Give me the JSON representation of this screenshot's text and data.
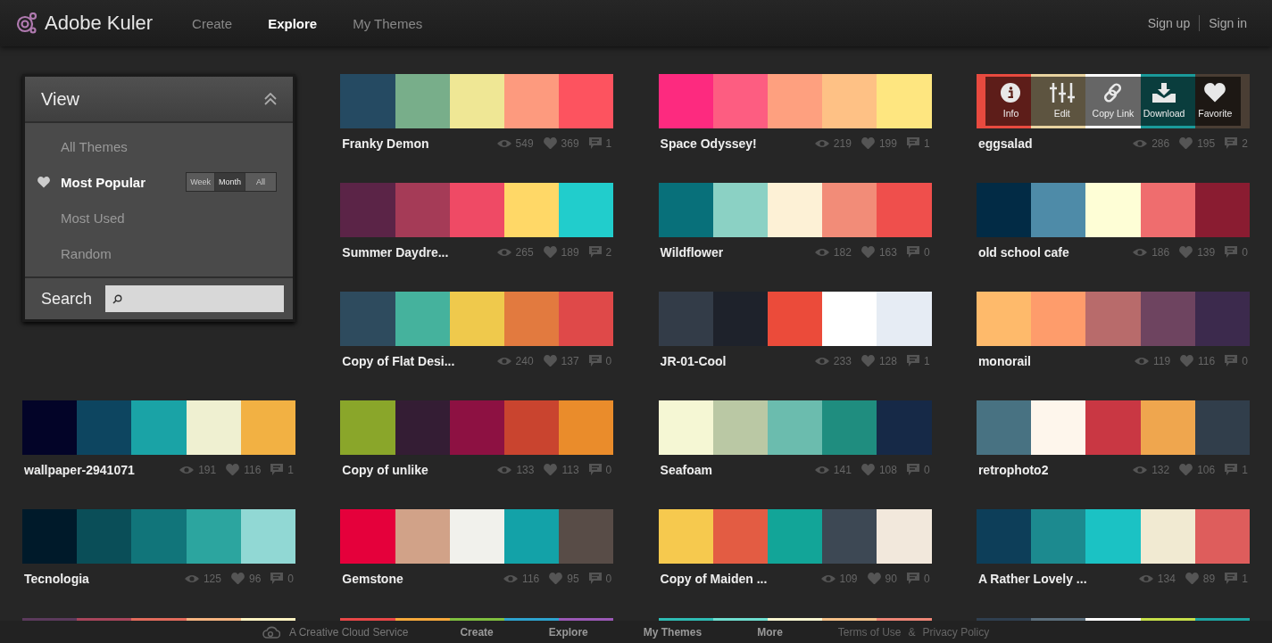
{
  "header": {
    "logo": "Adobe Kuler",
    "nav": [
      {
        "label": "Create",
        "selected": false
      },
      {
        "label": "Explore",
        "selected": true
      },
      {
        "label": "My Themes",
        "selected": false
      }
    ],
    "account": [
      "Sign up",
      "Sign in"
    ]
  },
  "sidebar": {
    "title": "View",
    "items": [
      {
        "label": "All Themes",
        "selected": false
      },
      {
        "label": "Most Popular",
        "selected": true
      },
      {
        "label": "Most Used",
        "selected": false
      },
      {
        "label": "Random",
        "selected": false
      }
    ],
    "range": [
      {
        "label": "Week",
        "selected": false
      },
      {
        "label": "Month",
        "selected": true
      },
      {
        "label": "All",
        "selected": false
      }
    ],
    "search_label": "Search"
  },
  "hover_actions": [
    {
      "kind": "info",
      "label": "Info"
    },
    {
      "kind": "edit",
      "label": "Edit"
    },
    {
      "kind": "link",
      "label": "Copy Link"
    },
    {
      "kind": "download",
      "label": "Download"
    },
    {
      "kind": "favorite",
      "label": "Favorite"
    }
  ],
  "themes": [
    {
      "name": "Franky Demon",
      "swatches": [
        {
          "color": "#254a62"
        },
        {
          "color": "#78ae8a"
        },
        {
          "color": "#efe795"
        },
        {
          "color": "#fd9a7e"
        },
        {
          "color": "#fd535f"
        }
      ],
      "views": "549",
      "likes": "369",
      "comments": "1",
      "hovered": false
    },
    {
      "name": "Space Odyssey!",
      "swatches": [
        {
          "color": "#fd2a7f"
        },
        {
          "color": "#fd5d81"
        },
        {
          "color": "#fea07f"
        },
        {
          "color": "#fec185"
        },
        {
          "color": "#fee680"
        }
      ],
      "views": "219",
      "likes": "199",
      "comments": "1",
      "hovered": false
    },
    {
      "name": "eggsalad",
      "swatches": [
        {
          "color": "#e84a3f"
        },
        {
          "color": "#e8d3a0"
        },
        {
          "color": "#ffffff"
        },
        {
          "color": "#1a9a9a"
        },
        {
          "color": "#4a3e34"
        }
      ],
      "views": "286",
      "likes": "195",
      "comments": "2",
      "hovered": true
    },
    {
      "name": "Summer Daydre...",
      "swatches": [
        {
          "color": "#5b2447"
        },
        {
          "color": "#a53b57"
        },
        {
          "color": "#ef4a65"
        },
        {
          "color": "#ffd867"
        },
        {
          "color": "#21cdcc"
        }
      ],
      "views": "265",
      "likes": "189",
      "comments": "2",
      "hovered": false
    },
    {
      "name": "Wildflower",
      "swatches": [
        {
          "color": "#08707a"
        },
        {
          "color": "#8bd1c4"
        },
        {
          "color": "#fdf1d6"
        },
        {
          "color": "#f28c78"
        },
        {
          "color": "#ef4f4c"
        }
      ],
      "views": "182",
      "likes": "163",
      "comments": "0",
      "hovered": false
    },
    {
      "name": "old school cafe",
      "swatches": [
        {
          "color": "#022b45"
        },
        {
          "color": "#4e8ba8"
        },
        {
          "color": "#fefed6"
        },
        {
          "color": "#ef6d6e"
        },
        {
          "color": "#8a1c31"
        }
      ],
      "views": "186",
      "likes": "139",
      "comments": "0",
      "hovered": false
    },
    {
      "name": "Copy of Flat Desi...",
      "swatches": [
        {
          "color": "#2e4b5e"
        },
        {
          "color": "#45b29d"
        },
        {
          "color": "#efc94c"
        },
        {
          "color": "#e27a3f"
        },
        {
          "color": "#df4949"
        }
      ],
      "views": "240",
      "likes": "137",
      "comments": "0",
      "hovered": false
    },
    {
      "name": "JR-01-Cool",
      "swatches": [
        {
          "color": "#333c48"
        },
        {
          "color": "#1e222b"
        },
        {
          "color": "#eb4b3a"
        },
        {
          "color": "#ffffff"
        },
        {
          "color": "#e6ecf4"
        }
      ],
      "views": "233",
      "likes": "128",
      "comments": "1",
      "hovered": false
    },
    {
      "name": "monorail",
      "swatches": [
        {
          "color": "#feba6b"
        },
        {
          "color": "#fe9c6b"
        },
        {
          "color": "#b86b6b"
        },
        {
          "color": "#6e4460"
        },
        {
          "color": "#3c2a4d"
        }
      ],
      "views": "119",
      "likes": "116",
      "comments": "0",
      "hovered": false
    },
    {
      "name": "wallpaper-2941071",
      "swatches": [
        {
          "color": "#030428"
        },
        {
          "color": "#0d4560"
        },
        {
          "color": "#1aa3a6"
        },
        {
          "color": "#eff0d1"
        },
        {
          "color": "#f2b143"
        }
      ],
      "views": "191",
      "likes": "116",
      "comments": "1",
      "hovered": false
    },
    {
      "name": "Copy of unlike",
      "swatches": [
        {
          "color": "#8aa62a"
        },
        {
          "color": "#341d34"
        },
        {
          "color": "#8d1142"
        },
        {
          "color": "#c9442f"
        },
        {
          "color": "#ea8c2b"
        }
      ],
      "views": "133",
      "likes": "113",
      "comments": "0",
      "hovered": false
    },
    {
      "name": "Seafoam",
      "swatches": [
        {
          "color": "#f5f7d4"
        },
        {
          "color": "#bac8a4"
        },
        {
          "color": "#6bbcae"
        },
        {
          "color": "#1f8d7f"
        },
        {
          "color": "#162947"
        }
      ],
      "views": "141",
      "likes": "108",
      "comments": "0",
      "hovered": false
    },
    {
      "name": "retrophoto2",
      "swatches": [
        {
          "color": "#487282"
        },
        {
          "color": "#fef6ec"
        },
        {
          "color": "#c93743"
        },
        {
          "color": "#efa64e"
        },
        {
          "color": "#313e4b"
        }
      ],
      "views": "132",
      "likes": "106",
      "comments": "1",
      "hovered": false
    },
    {
      "name": "Tecnologia",
      "swatches": [
        {
          "color": "#001a2a"
        },
        {
          "color": "#0a4e58"
        },
        {
          "color": "#11757a"
        },
        {
          "color": "#2ca59f"
        },
        {
          "color": "#91d8d4"
        }
      ],
      "views": "125",
      "likes": "96",
      "comments": "0",
      "hovered": false
    },
    {
      "name": "Gemstone",
      "swatches": [
        {
          "color": "#e5003b"
        },
        {
          "color": "#d1a288"
        },
        {
          "color": "#f1f1ec"
        },
        {
          "color": "#13a2a8"
        },
        {
          "color": "#584c47"
        }
      ],
      "views": "116",
      "likes": "95",
      "comments": "0",
      "hovered": false
    },
    {
      "name": "Copy of Maiden ...",
      "swatches": [
        {
          "color": "#f6c94e"
        },
        {
          "color": "#e35c43"
        },
        {
          "color": "#12a598"
        },
        {
          "color": "#3d4854"
        },
        {
          "color": "#f2e8dc"
        }
      ],
      "views": "109",
      "likes": "90",
      "comments": "0",
      "hovered": false
    },
    {
      "name": "A Rather Lovely ...",
      "swatches": [
        {
          "color": "#0d3e59"
        },
        {
          "color": "#1c8a8f"
        },
        {
          "color": "#1bc2c4"
        },
        {
          "color": "#f1ead2"
        },
        {
          "color": "#de5d5c"
        }
      ],
      "views": "134",
      "likes": "89",
      "comments": "1",
      "hovered": false
    }
  ],
  "partial_row": [
    {
      "swatches": [
        {
          "color": "#5b3a5c"
        },
        {
          "color": "#a8455b"
        },
        {
          "color": "#e36b5c"
        },
        {
          "color": "#f7b581"
        },
        {
          "color": "#fff3c2"
        }
      ]
    },
    {
      "swatches": [
        {
          "color": "#e84747"
        },
        {
          "color": "#f6a93b"
        },
        {
          "color": "#7fbf3f"
        },
        {
          "color": "#2da3cf"
        },
        {
          "color": "#9b59b6"
        }
      ]
    },
    {
      "swatches": [
        {
          "color": "#2ebcb4"
        },
        {
          "color": "#6fdfd0"
        },
        {
          "color": "#f8f5d0"
        },
        {
          "color": "#f5c28a"
        },
        {
          "color": "#ee8677"
        }
      ]
    },
    {
      "swatches": [
        {
          "color": "#2f3f4f"
        },
        {
          "color": "#5c6f7d"
        },
        {
          "color": "#ffffff"
        },
        {
          "color": "#c7e04a"
        },
        {
          "color": "#1da5a2"
        }
      ]
    }
  ],
  "footer": {
    "service": "A Creative Cloud Service",
    "links": [
      "Create",
      "Explore",
      "My Themes",
      "More"
    ],
    "legal": [
      "Terms of Use",
      "&",
      "Privacy Policy"
    ]
  }
}
